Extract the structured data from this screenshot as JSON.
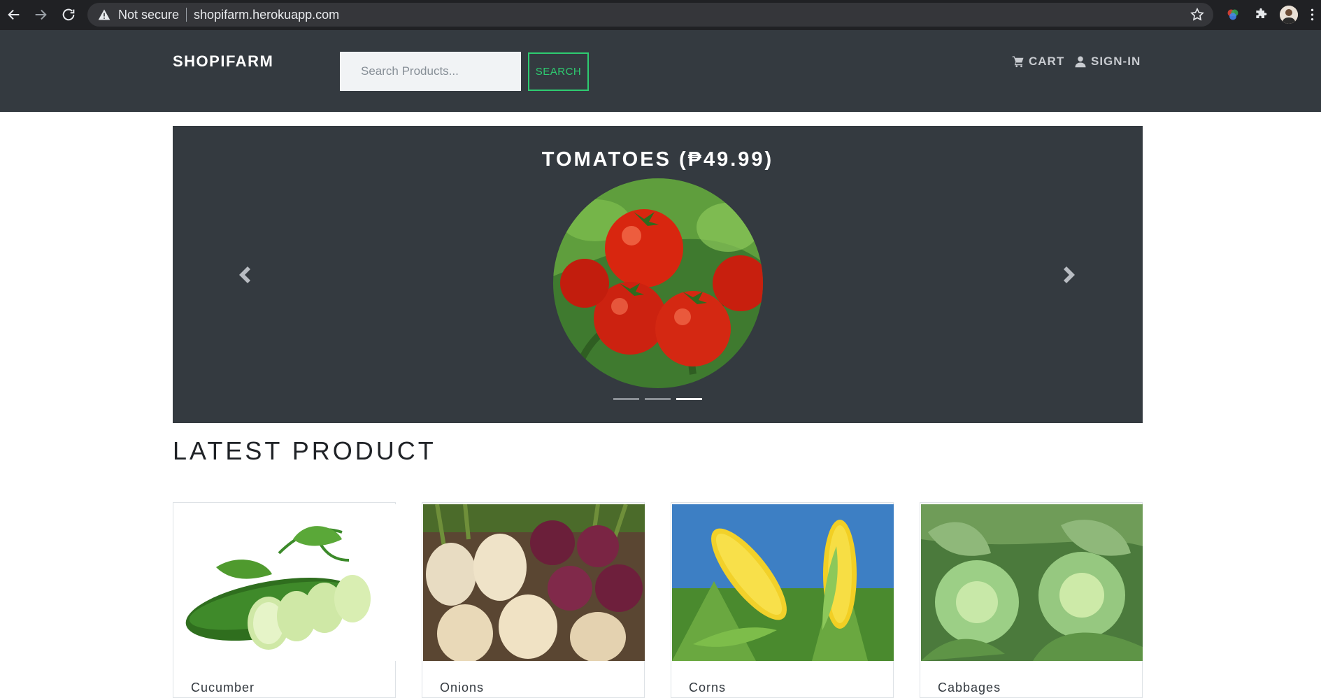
{
  "browser": {
    "security_label": "Not secure",
    "url": "shopifarm.herokuapp.com"
  },
  "header": {
    "brand": "SHOPIFARM",
    "search_placeholder": "Search Products...",
    "search_button": "SEARCH",
    "cart_label": "CART",
    "signin_label": "SIGN-IN"
  },
  "carousel": {
    "title": "TOMATOES (₱49.99)",
    "slide_count": 3,
    "active_index": 2
  },
  "latest": {
    "title": "LATEST PRODUCT",
    "products": [
      {
        "name": "Cucumber"
      },
      {
        "name": "Onions"
      },
      {
        "name": "Corns"
      },
      {
        "name": "Cabbages"
      }
    ]
  },
  "colors": {
    "header_bg": "#343a40",
    "accent_green": "#2ecc71"
  }
}
